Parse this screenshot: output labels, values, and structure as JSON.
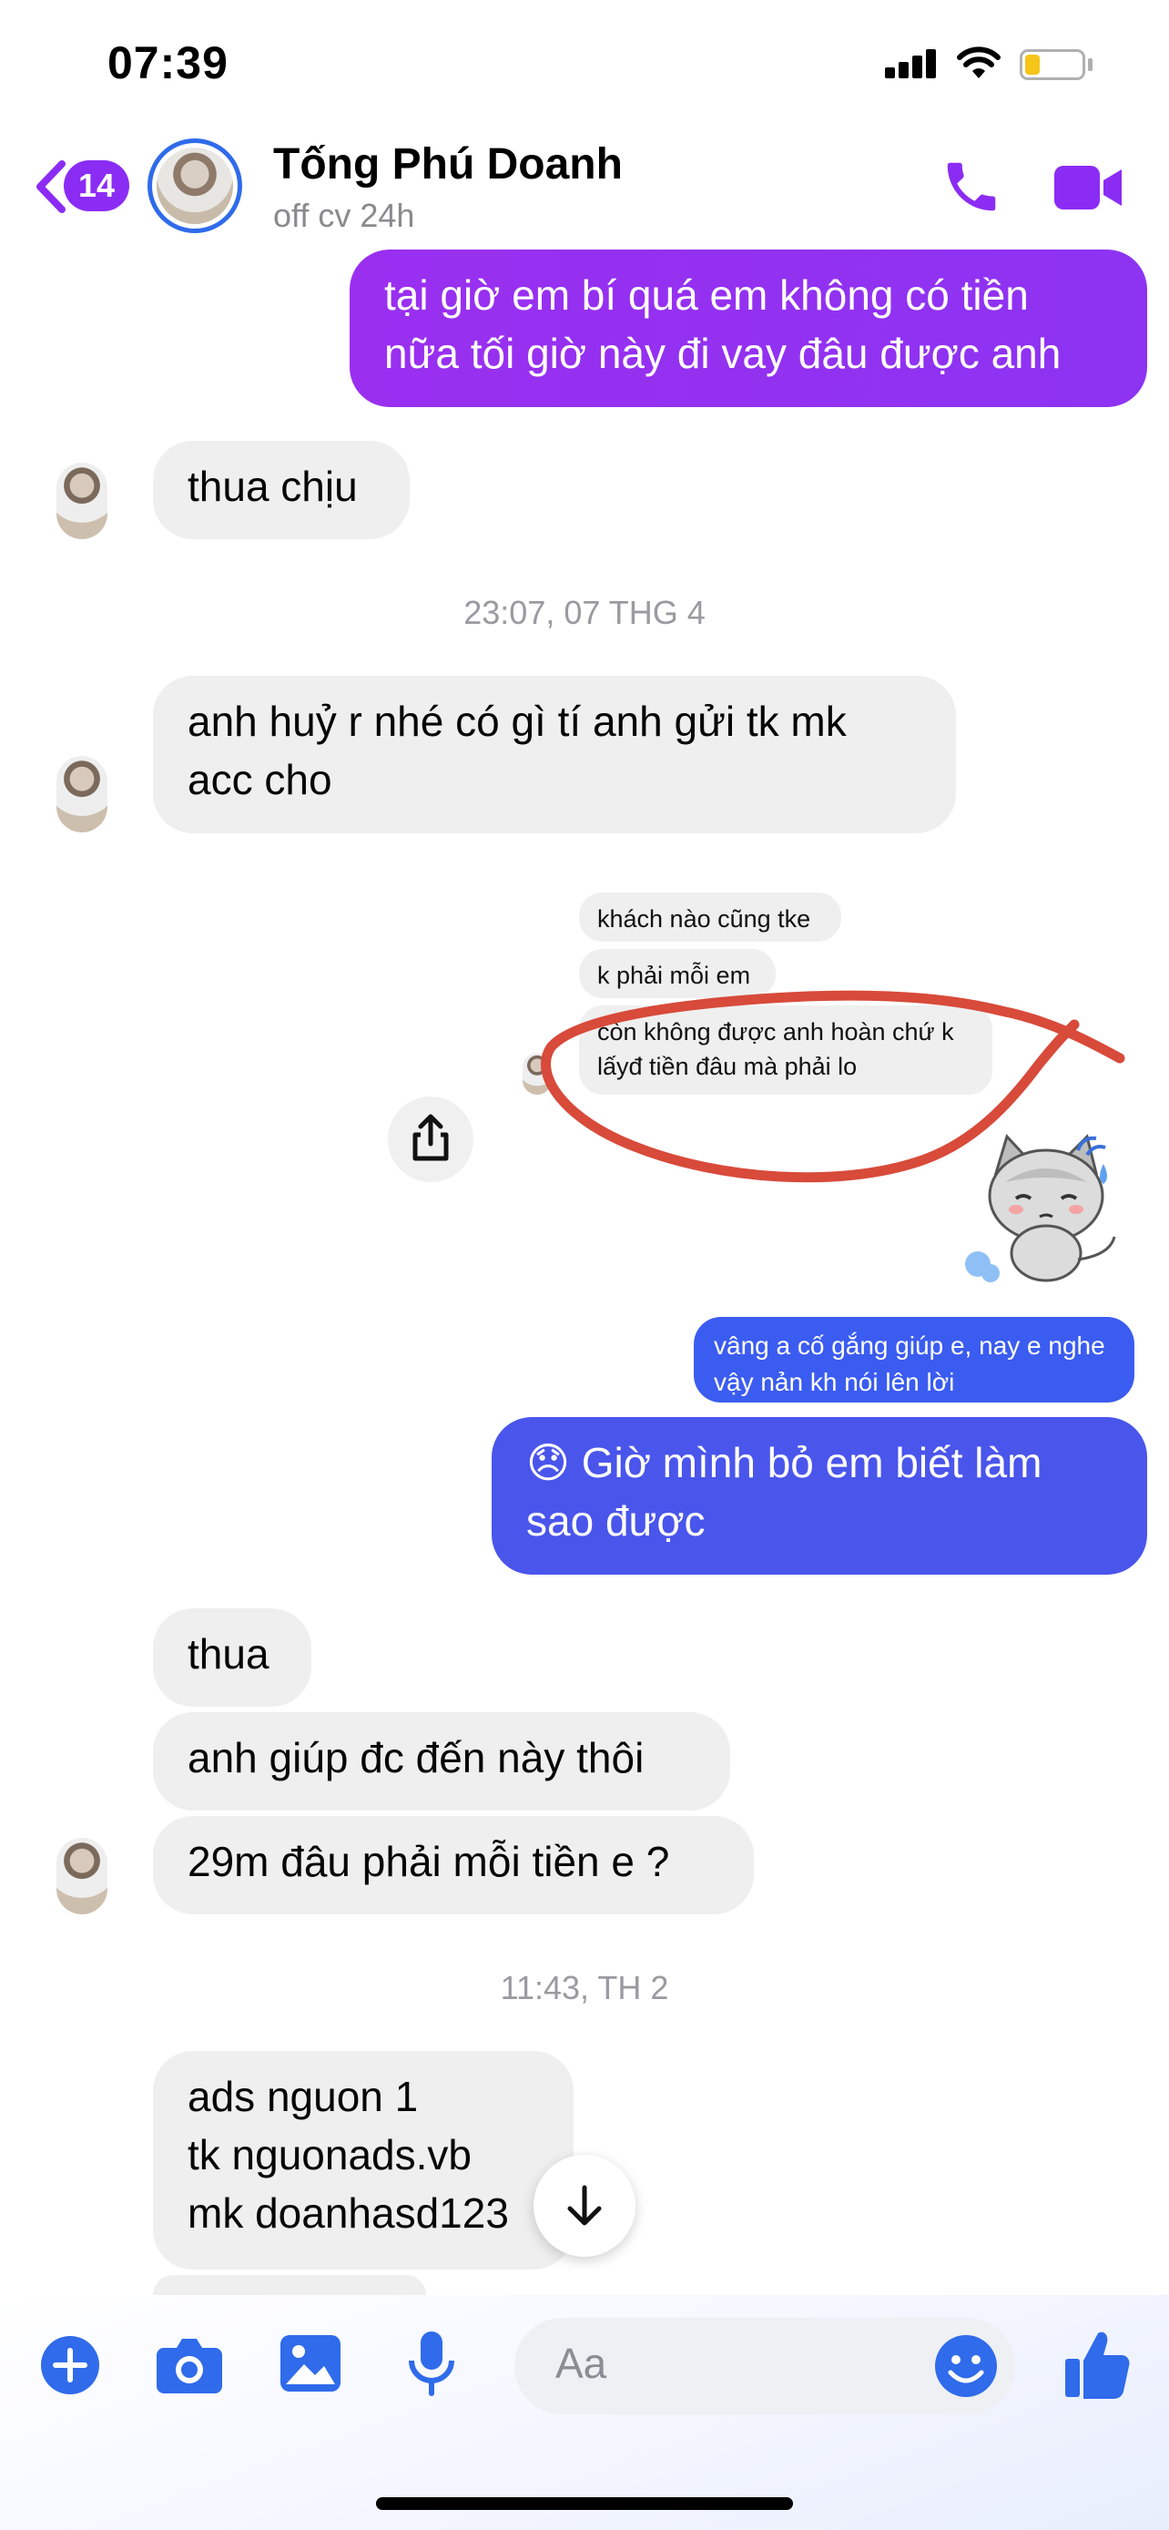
{
  "status_bar": {
    "time": "07:39",
    "battery_level": 0.2
  },
  "header": {
    "back_count": "14",
    "contact_name": "Tống Phú Doanh",
    "contact_status": "off cv 24h",
    "call_icon": "phone-icon",
    "video_icon": "video-camera-icon",
    "accent_color": "#8b2cf5"
  },
  "messages": {
    "m1": "tại giờ em bí quá em không có tiền nữa tối giờ này đi vay đâu được anh",
    "m2": "thua chịu",
    "sep1": "23:07, 07 THG 4",
    "m3": "anh huỷ r nhé có gì tí anh gửi tk mk acc cho",
    "quoted": {
      "q1": "khách nào cũng tke",
      "q2": "k phải mỗi em",
      "q3": "còn không được anh hoàn chứ k lấyđ tiền đâu mà phải lo",
      "q4": "vâng a cố gắng giúp e, nay e nghe vậy nản kh nói lên lời"
    },
    "m4": "😞 Giờ mình bỏ em biết làm sao được",
    "m5": "thua",
    "m6": "anh giúp đc đến này thôi",
    "m7": "29m đâu phải mỗi tiền e ?",
    "sep2": "11:43, TH 2",
    "m8_line1": "ads nguon 1",
    "m8_line2": "tk nguonads.vb",
    "m8_line3": "mk doanhasd123"
  },
  "composer": {
    "placeholder": "Aa",
    "icons": [
      "plus-icon",
      "camera-icon",
      "image-icon",
      "microphone-icon",
      "emoji-icon",
      "thumbs-up-icon"
    ]
  },
  "colors": {
    "outgoing_purple": "#8e2ef0",
    "outgoing_blue": "#4a55ec",
    "incoming_gray": "#efefef",
    "annotation_red": "#d84a3a"
  }
}
